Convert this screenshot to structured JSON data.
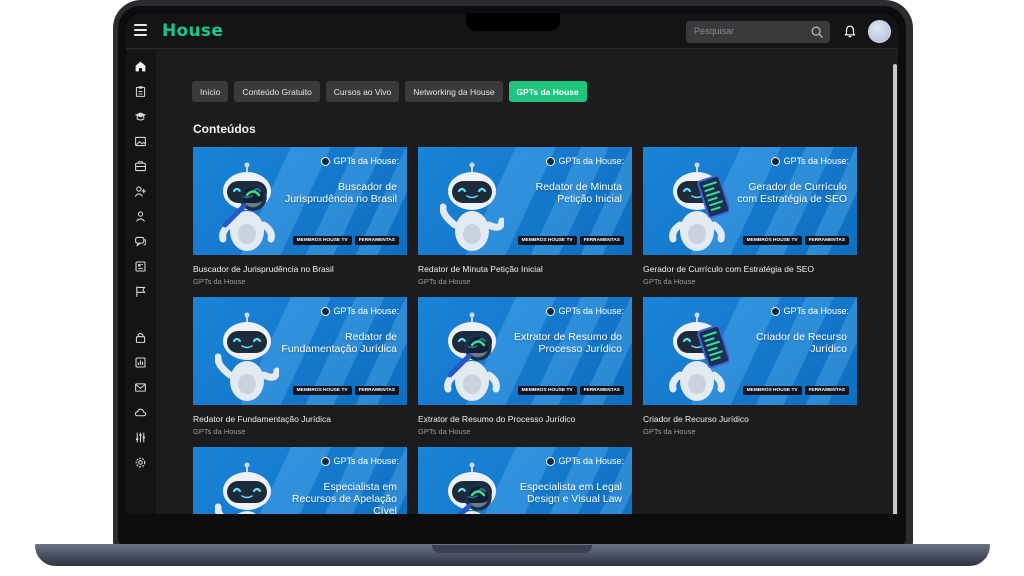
{
  "app": {
    "logo_text": "House",
    "search_placeholder": "Pesquisar"
  },
  "nav_tabs": [
    {
      "label": "Início",
      "active": false
    },
    {
      "label": "Conteúdo Gratuito",
      "active": false
    },
    {
      "label": "Cursos ao Vivo",
      "active": false
    },
    {
      "label": "Networking da House",
      "active": false
    },
    {
      "label": "GPTs da House",
      "active": true
    }
  ],
  "section_title": "Conteúdos",
  "sidebar_icons": [
    "home-icon",
    "clipboard-icon",
    "graduation-cap-icon",
    "image-icon",
    "box-icon",
    "user-plus-icon",
    "users-icon",
    "chat-icon",
    "newspaper-icon",
    "flag-icon",
    "lock-icon",
    "chart-icon",
    "mail-icon",
    "cloud-icon",
    "sliders-icon",
    "gear-icon"
  ],
  "cards": [
    {
      "badge": "GPTs da House:",
      "headline": "Buscador de Jurisprudência no Brasil",
      "chip1": "MEMBROS HOUSE TV",
      "chip2": "FERRAMENTAS",
      "title": "Buscador de Jurisprudência no Brasil",
      "subtitle": "GPTs da House",
      "robot_prop": "magnifier"
    },
    {
      "badge": "GPTs da House:",
      "headline": "Redator de Minuta Petição Inicial",
      "chip1": "MEMBROS HOUSE TV",
      "chip2": "FERRAMENTAS",
      "title": "Redator de Minuta Petição Inicial",
      "subtitle": "GPTs da House",
      "robot_prop": "wave"
    },
    {
      "badge": "GPTs da House:",
      "headline": "Gerador de Currículo com Estratégia de SEO",
      "chip1": "MEMBROS HOUSE TV",
      "chip2": "FERRAMENTAS",
      "title": "Gerador de Currículo com Estratégia de SEO",
      "subtitle": "GPTs da House",
      "robot_prop": "tablet"
    },
    {
      "badge": "GPTs da House:",
      "headline": "Redator de Fundamentação Jurídica",
      "chip1": "MEMBROS HOUSE TV",
      "chip2": "FERRAMENTAS",
      "title": "Redator de Fundamentação Jurídica",
      "subtitle": "GPTs da House",
      "robot_prop": "wave"
    },
    {
      "badge": "GPTs da House:",
      "headline": "Extrator de Resumo do Processo Jurídico",
      "chip1": "MEMBROS HOUSE TV",
      "chip2": "FERRAMENTAS",
      "title": "Extrator de Resumo do Processo Jurídico",
      "subtitle": "GPTs da House",
      "robot_prop": "magnifier"
    },
    {
      "badge": "GPTs da House:",
      "headline": "Criador de Recurso Jurídico",
      "chip1": "MEMBROS HOUSE TV",
      "chip2": "FERRAMENTAS",
      "title": "Criador de Recurso Jurídico",
      "subtitle": "GPTs da House",
      "robot_prop": "tablet"
    },
    {
      "badge": "GPTs da House:",
      "headline": "Especialista em Recursos de Apelação Cível",
      "chip1": "",
      "chip2": "",
      "title": "",
      "subtitle": "",
      "robot_prop": "wave"
    },
    {
      "badge": "GPTs da House:",
      "headline": "Especialista em Legal Design e Visual Law",
      "chip1": "",
      "chip2": "",
      "title": "",
      "subtitle": "",
      "robot_prop": "magnifier"
    }
  ],
  "colors": {
    "accent": "#1fc57f",
    "logo": "#16c88c",
    "thumb_blue": "#1a84d8",
    "background": "#1c1c1e"
  }
}
